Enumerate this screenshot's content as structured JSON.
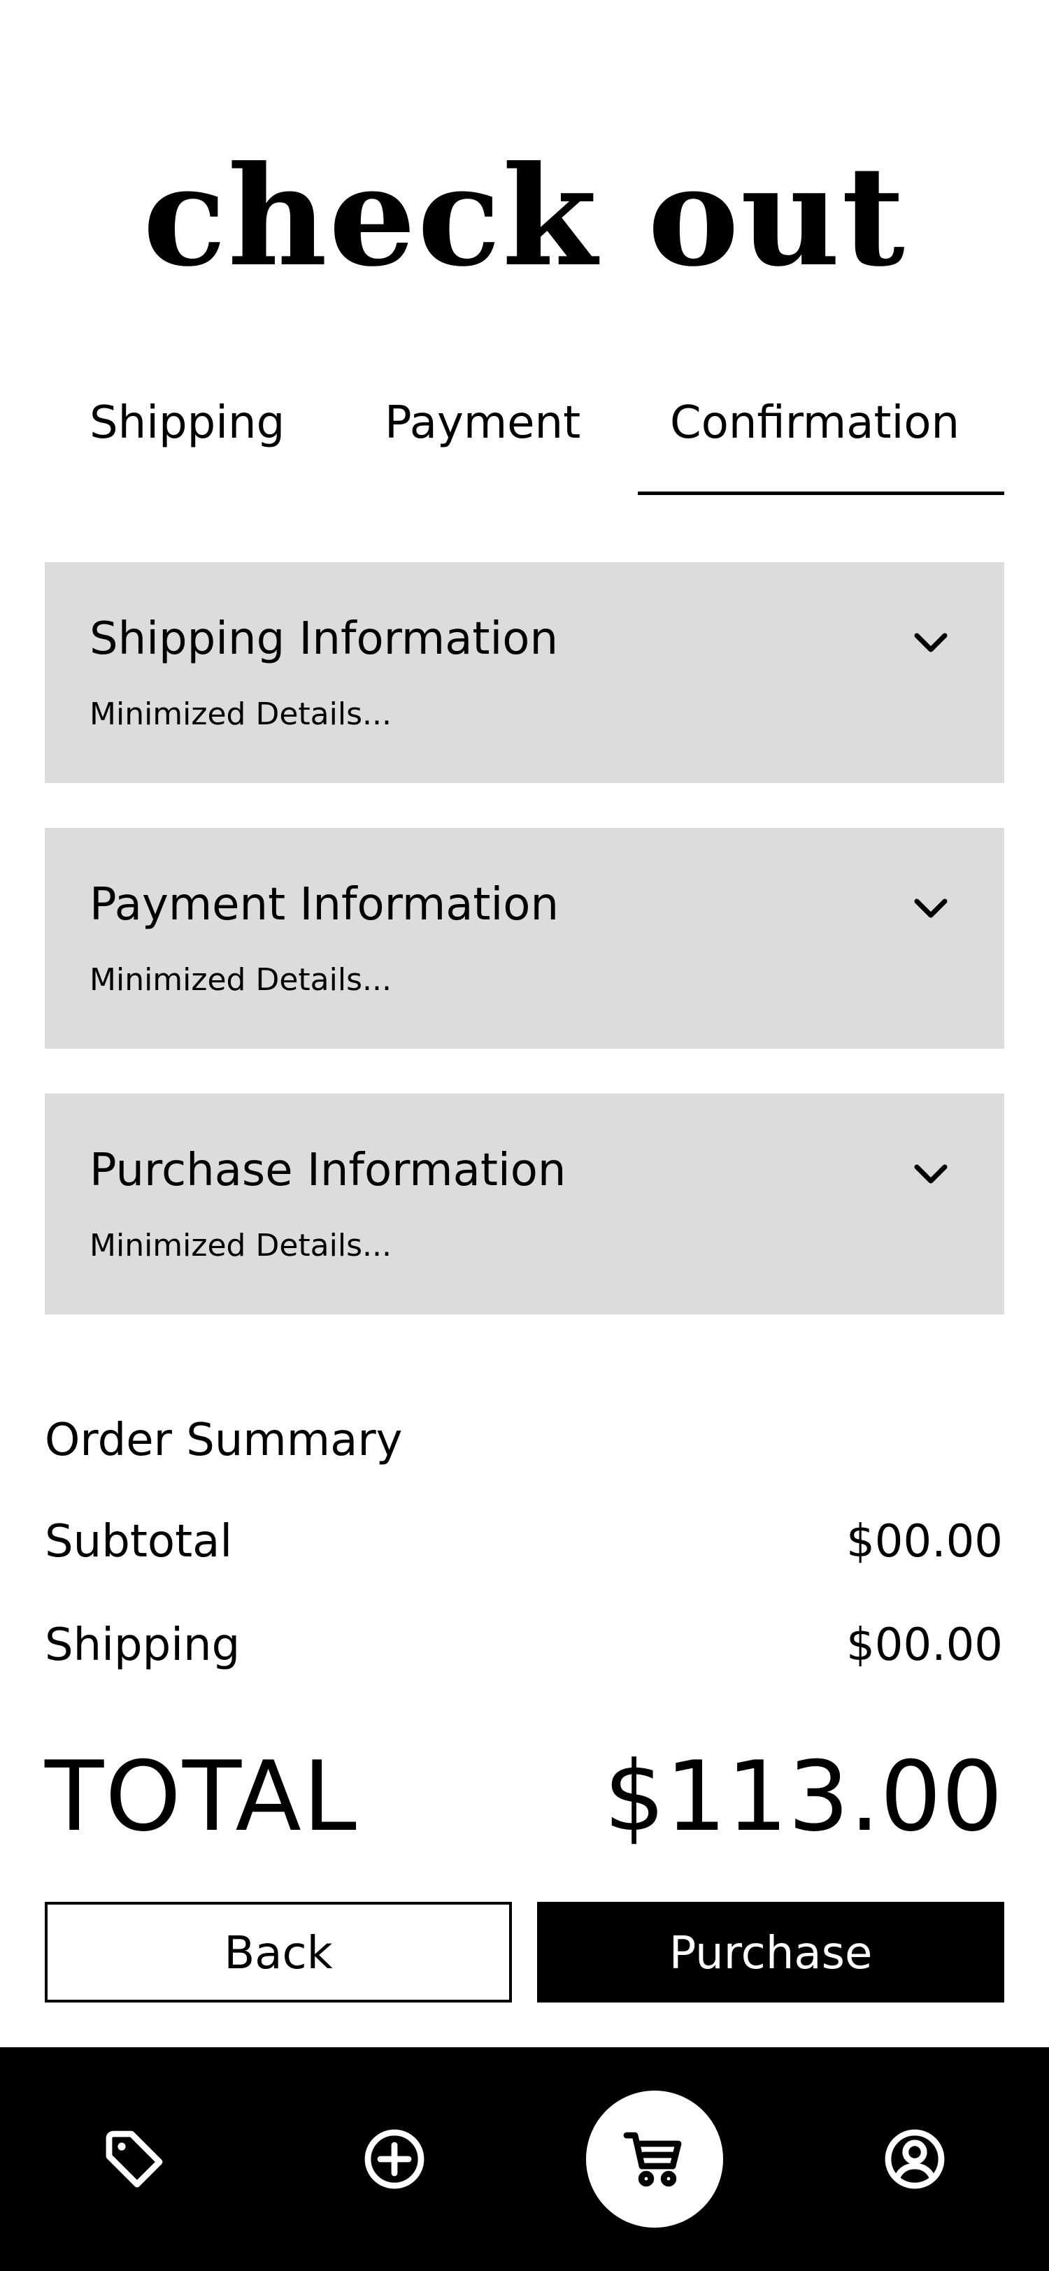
{
  "header": {
    "title": "check out"
  },
  "tabs": [
    {
      "label": "Shipping",
      "active": false
    },
    {
      "label": "Payment",
      "active": false
    },
    {
      "label": "Confirmation",
      "active": true
    }
  ],
  "sections": [
    {
      "title": "Shipping Information",
      "details": "Minimized Details..."
    },
    {
      "title": "Payment Information",
      "details": "Minimized Details..."
    },
    {
      "title": "Purchase Information",
      "details": "Minimized Details..."
    }
  ],
  "summary": {
    "title": "Order Summary",
    "subtotal_label": "Subtotal",
    "subtotal_value": "$00.00",
    "shipping_label": "Shipping",
    "shipping_value": "$00.00",
    "total_label": "TOTAL",
    "total_value": "$113.00"
  },
  "actions": {
    "back_label": "Back",
    "purchase_label": "Purchase"
  },
  "bottom_nav": {
    "items": [
      {
        "icon": "tag-icon",
        "active": false
      },
      {
        "icon": "plus-circle-icon",
        "active": false
      },
      {
        "icon": "cart-icon",
        "active": true
      },
      {
        "icon": "user-circle-icon",
        "active": false
      }
    ]
  },
  "colors": {
    "background": "#ffffff",
    "text": "#000000",
    "panel": "#dcdcdc",
    "nav_background": "#000000",
    "primary_button": "#000000"
  }
}
